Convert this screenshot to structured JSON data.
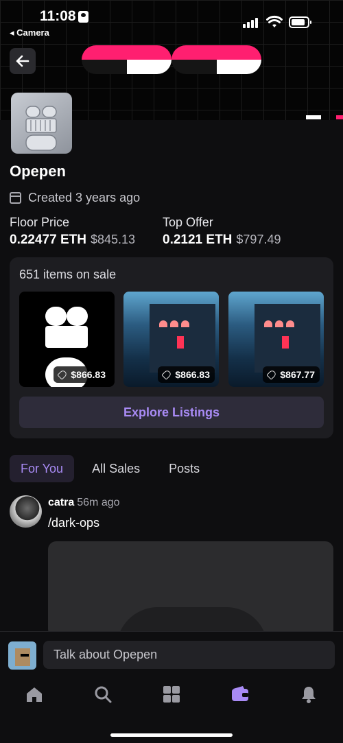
{
  "status_bar": {
    "time": "11:08",
    "back_app": "◂ Camera"
  },
  "collection": {
    "name": "Opepen",
    "created": "Created 3 years ago"
  },
  "stats": {
    "floor": {
      "label": "Floor Price",
      "eth": "0.22477 ETH",
      "usd": "$845.13"
    },
    "offer": {
      "label": "Top Offer",
      "eth": "0.2121 ETH",
      "usd": "$797.49"
    }
  },
  "sale": {
    "title": "651 items on sale",
    "items": [
      {
        "price": "$866.83"
      },
      {
        "price": "$866.83"
      },
      {
        "price": "$867.77"
      }
    ],
    "explore_label": "Explore Listings"
  },
  "tabs": [
    "For You",
    "All Sales",
    "Posts"
  ],
  "post": {
    "user": "catra",
    "ago": "56m ago",
    "channel": "/dark-ops"
  },
  "composer": {
    "placeholder": "Talk about Opepen"
  },
  "colors": {
    "accent": "#a98bf5",
    "brand_pink": "#ff1f70"
  },
  "tabbar_icons": [
    "home-icon",
    "search-icon",
    "grid-icon",
    "wallet-icon",
    "bell-icon"
  ]
}
